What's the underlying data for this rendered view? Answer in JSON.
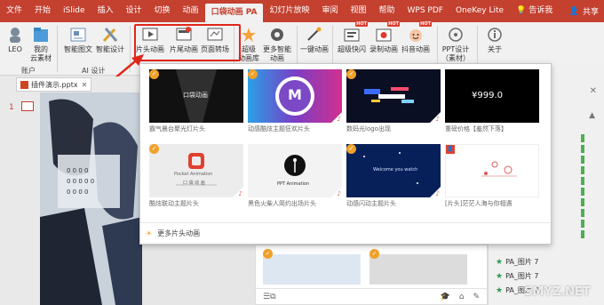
{
  "tabs": [
    "文件",
    "开始",
    "iSlide",
    "插入",
    "设计",
    "切换",
    "动画",
    "口袋动画 PA",
    "幻灯片放映",
    "审阅",
    "视图",
    "帮助",
    "WPS PDF",
    "OneKey Lite",
    "告诉我"
  ],
  "active_tab_index": 7,
  "share_label": "共享",
  "ribbon": {
    "btn_leo": "LEO",
    "btn_mycloud_1": "我的",
    "btn_mycloud_2": "云素材",
    "group_account": "账户",
    "btn_smartgraphic": "智能图文",
    "btn_smartdesign": "智能设计",
    "group_ai": "AI 设计",
    "btn_intro": "片头动画",
    "btn_outro": "片尾动画",
    "btn_transition": "页面转场",
    "btn_superlib_1": "超级",
    "btn_superlib_2": "动画库",
    "btn_more_1": "更多智能",
    "btn_more_2": "动画",
    "btn_oneclick": "一键动画",
    "btn_superflash": "超级快闪",
    "btn_record": "录制动画",
    "btn_douyin": "抖音动画",
    "btn_pptdesign_1": "PPT设计",
    "btn_pptdesign_2": "（素材）",
    "btn_about": "关于",
    "hot_label": "HOT"
  },
  "doc_tab": "插件演示.pptx",
  "slide_number": "1",
  "popup": {
    "cards": [
      {
        "caption": "霸气晨台聚光灯片头",
        "thumb_text": "口袋动画"
      },
      {
        "caption": "动感酷炫主题狂欢片头",
        "thumb_text": "M"
      },
      {
        "caption": "数码光logo出现",
        "thumb_text": ""
      },
      {
        "caption": "重磅价格【羞然下落】",
        "thumb_text": "¥999.0"
      },
      {
        "caption": "酷炫联动主题片头",
        "thumb_text": "Pocket Animation",
        "thumb_sub": "口 袋 动 画"
      },
      {
        "caption": "黑色火柴人简约出场片头",
        "thumb_text": "PPT Animation"
      },
      {
        "caption": "动感闪动主题片头",
        "thumb_text": "Welcome you watch"
      },
      {
        "caption": "[片头]茫茫人海与你相遇",
        "thumb_text": ""
      }
    ],
    "more_label": "更多片头动画"
  },
  "right_panel": {
    "items": [
      "PA_图片 7",
      "PA_图片 7",
      "PA_图片 7"
    ]
  },
  "watermark": "SMYZ.NET"
}
